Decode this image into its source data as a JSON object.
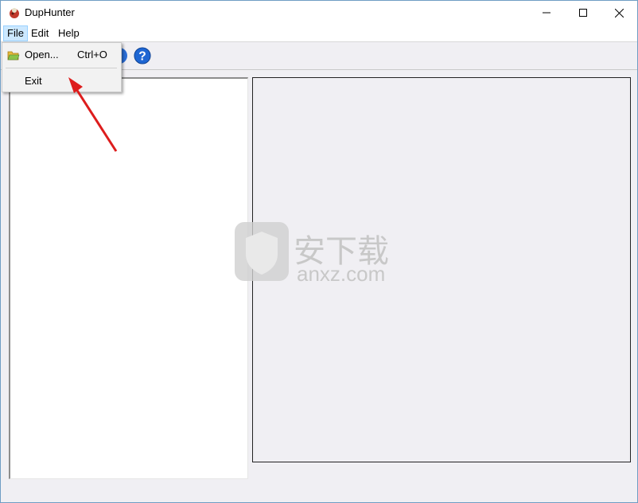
{
  "window": {
    "title": "DupHunter"
  },
  "controls": {
    "minimize_icon": "minimize-icon",
    "maximize_icon": "maximize-icon",
    "close_icon": "close-icon"
  },
  "menubar": {
    "items": [
      {
        "label": "File"
      },
      {
        "label": "Edit"
      },
      {
        "label": "Help"
      }
    ]
  },
  "file_menu": {
    "items": [
      {
        "label": "Open...",
        "shortcut": "Ctrl+O",
        "icon": "open-folder-icon"
      },
      {
        "label": "Exit",
        "shortcut": ""
      }
    ]
  },
  "toolbar": {
    "icons": [
      "open-folder-icon",
      "info-icon",
      "help-icon"
    ]
  },
  "watermark": {
    "cn": "安下载",
    "en": "anxz.com"
  },
  "colors": {
    "accent_selection": "#cce8ff",
    "annotation_arrow": "#dd1d1d",
    "help_icon": "#1e66d3"
  }
}
